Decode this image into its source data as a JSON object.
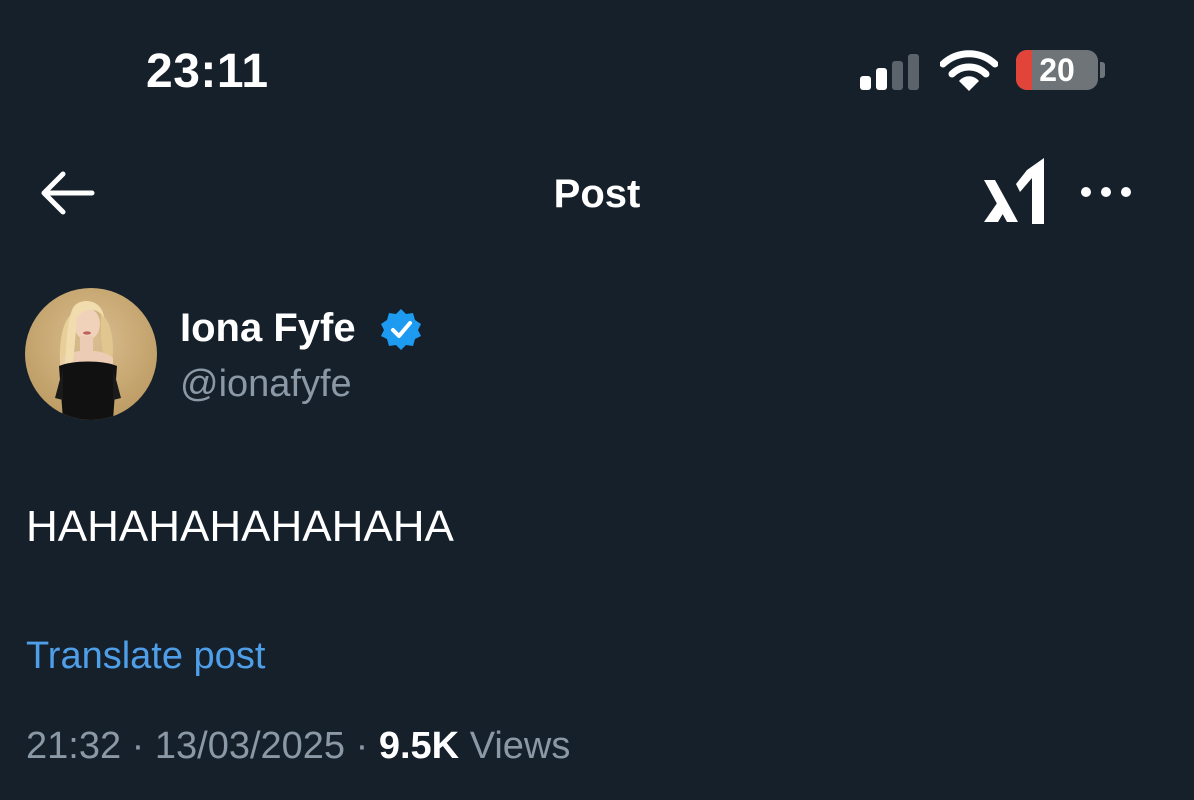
{
  "status_bar": {
    "time": "23:11",
    "signal_bars_active": 2,
    "signal_bars_total": 4,
    "battery_percent": 20,
    "battery_label": "20",
    "battery_low_color": "#e2443a"
  },
  "nav": {
    "title": "Post",
    "back_icon": "arrow-left-icon",
    "grok_icon": "grok-icon",
    "more_icon": "ellipsis-icon"
  },
  "post": {
    "author": {
      "display_name": "Iona Fyfe",
      "handle": "@ionafyfe",
      "verified": true,
      "verified_color": "#1d9bf0"
    },
    "text": "HAHAHAHAHAHAHA",
    "translate_label": "Translate post",
    "time": "21:32",
    "separator": "·",
    "date": "13/03/2025",
    "views_count": "9.5K",
    "views_label": "Views"
  },
  "colors": {
    "background": "#15202b",
    "secondary_text": "#8b98a5",
    "link": "#4f9ee8"
  }
}
